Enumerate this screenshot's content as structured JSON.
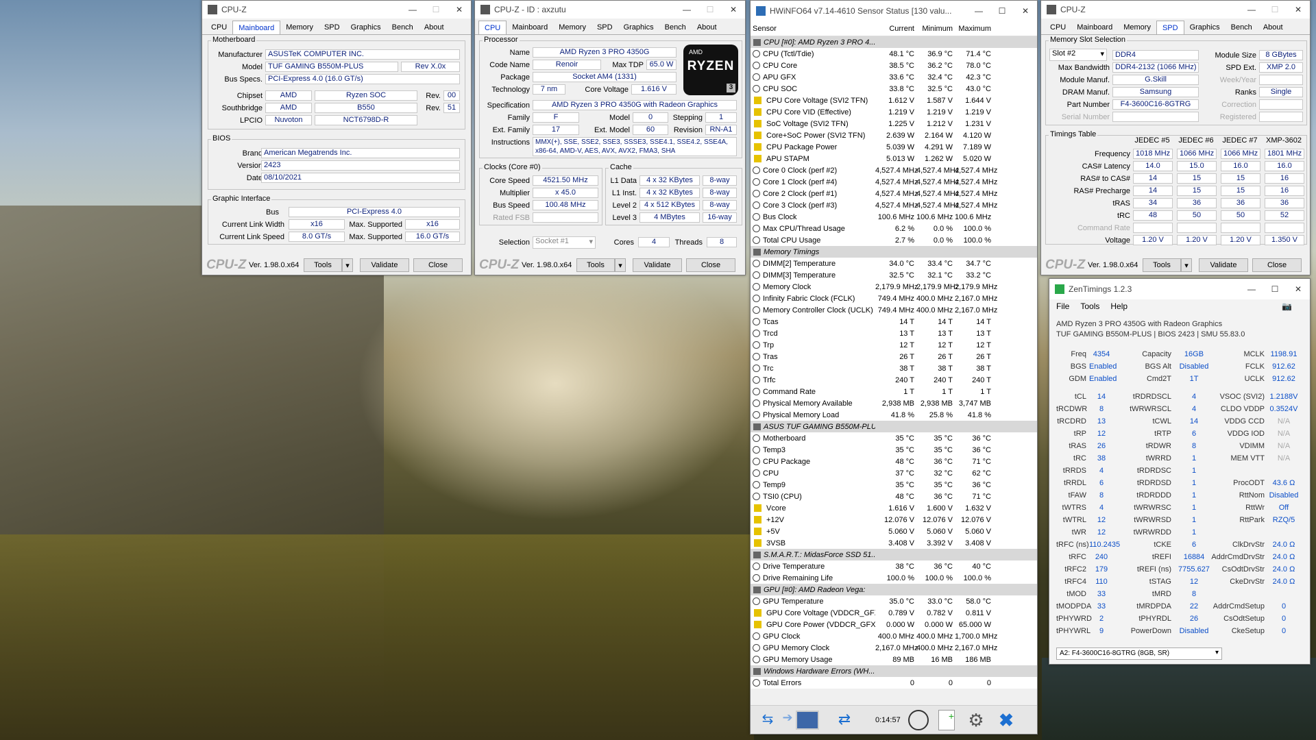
{
  "cpuz1": {
    "title": "CPU-Z",
    "tabs": [
      "CPU",
      "Mainboard",
      "Memory",
      "SPD",
      "Graphics",
      "Bench",
      "About"
    ],
    "active_tab": "Mainboard",
    "mb": {
      "title": "Motherboard",
      "manufacturer": "ASUSTeK COMPUTER INC.",
      "model": "TUF GAMING B550M-PLUS",
      "model_rev": "Rev X.0x",
      "bus_specs": "PCI-Express 4.0 (16.0 GT/s)",
      "chipset_vendor": "AMD",
      "chipset": "Ryzen SOC",
      "chipset_rev": "00",
      "sb_vendor": "AMD",
      "sb": "B550",
      "sb_rev": "51",
      "lpcio_vendor": "Nuvoton",
      "lpcio": "NCT6798D-R"
    },
    "labels": {
      "manufacturer": "Manufacturer",
      "model": "Model",
      "bus_specs": "Bus Specs.",
      "chipset": "Chipset",
      "southbridge": "Southbridge",
      "lpcio": "LPCIO",
      "rev": "Rev.",
      "brand": "Brand",
      "version": "Version",
      "date": "Date",
      "bus": "Bus",
      "cur_width": "Current Link Width",
      "max_sup": "Max. Supported",
      "cur_speed": "Current Link Speed"
    },
    "bios": {
      "title": "BIOS",
      "brand": "American Megatrends Inc.",
      "version": "2423",
      "date": "08/10/2021"
    },
    "gi": {
      "title": "Graphic Interface",
      "bus": "PCI-Express 4.0",
      "cur_width": "x16",
      "max_width": "x16",
      "cur_speed": "8.0 GT/s",
      "max_speed": "16.0 GT/s"
    },
    "footer": {
      "logo": "CPU-Z",
      "version": "Ver. 1.98.0.x64",
      "tools": "Tools",
      "validate": "Validate",
      "close": "Close"
    }
  },
  "cpuz2": {
    "title": "CPU-Z - ID : axzutu",
    "tabs": [
      "CPU",
      "Mainboard",
      "Memory",
      "SPD",
      "Graphics",
      "Bench",
      "About"
    ],
    "active_tab": "CPU",
    "labels": {
      "processor": "Processor",
      "name": "Name",
      "code_name": "Code Name",
      "max_tdp": "Max TDP",
      "package": "Package",
      "technology": "Technology",
      "core_voltage": "Core Voltage",
      "specification": "Specification",
      "family": "Family",
      "model": "Model",
      "stepping": "Stepping",
      "ext_family": "Ext. Family",
      "ext_model": "Ext. Model",
      "revision": "Revision",
      "instructions": "Instructions",
      "clocks": "Clocks (Core #0)",
      "core_speed": "Core Speed",
      "multiplier": "Multiplier",
      "bus_speed": "Bus Speed",
      "rated_fsb": "Rated FSB",
      "cache": "Cache",
      "l1d": "L1 Data",
      "l1i": "L1 Inst.",
      "l2": "Level 2",
      "l3": "Level 3",
      "selection": "Selection",
      "cores": "Cores",
      "threads": "Threads"
    },
    "proc": {
      "name": "AMD Ryzen 3 PRO 4350G",
      "code_name": "Renoir",
      "max_tdp": "65.0 W",
      "package": "Socket AM4 (1331)",
      "technology": "7 nm",
      "core_voltage": "1.616 V",
      "specification": "AMD Ryzen 3 PRO 4350G with Radeon Graphics",
      "family": "F",
      "model": "0",
      "stepping": "1",
      "ext_family": "17",
      "ext_model": "60",
      "revision": "RN-A1",
      "instructions1": "MMX(+), SSE, SSE2, SSE3, SSSE3, SSE4.1, SSE4.2, SSE4A,",
      "instructions2": "x86-64, AMD-V, AES, AVX, AVX2, FMA3, SHA"
    },
    "badge": {
      "brand": "AMD",
      "line": "RYZEN",
      "tier": "3"
    },
    "clocks": {
      "core_speed": "4521.50 MHz",
      "multiplier": "x 45.0",
      "bus_speed": "100.48 MHz",
      "rated_fsb": ""
    },
    "cache": {
      "l1d": "4 x 32 KBytes",
      "l1d_way": "8-way",
      "l1i": "4 x 32 KBytes",
      "l1i_way": "8-way",
      "l2": "4 x 512 KBytes",
      "l2_way": "8-way",
      "l3": "4 MBytes",
      "l3_way": "16-way"
    },
    "sel": {
      "selection": "Socket #1",
      "cores": "4",
      "threads": "8"
    },
    "footer": {
      "logo": "CPU-Z",
      "version": "Ver. 1.98.0.x64",
      "tools": "Tools",
      "validate": "Validate",
      "close": "Close"
    }
  },
  "hwinfo": {
    "title": "HWiNFO64 v7.14-4610 Sensor Status [130 valu...",
    "headers": [
      "Sensor",
      "Current",
      "Minimum",
      "Maximum"
    ],
    "rows": [
      {
        "t": "s",
        "n": "CPU [#0]: AMD Ryzen 3 PRO 4..."
      },
      {
        "t": "t",
        "n": "CPU (Tctl/Tdie)",
        "c": "48.1 °C",
        "mi": "36.9 °C",
        "ma": "71.4 °C"
      },
      {
        "t": "t",
        "n": "CPU Core",
        "c": "38.5 °C",
        "mi": "36.2 °C",
        "ma": "78.0 °C"
      },
      {
        "t": "t",
        "n": "APU GFX",
        "c": "33.6 °C",
        "mi": "32.4 °C",
        "ma": "42.3 °C"
      },
      {
        "t": "t",
        "n": "CPU SOC",
        "c": "33.8 °C",
        "mi": "32.5 °C",
        "ma": "43.0 °C"
      },
      {
        "t": "v",
        "n": "CPU Core Voltage (SVI2 TFN)",
        "c": "1.612 V",
        "mi": "1.587 V",
        "ma": "1.644 V"
      },
      {
        "t": "v",
        "n": "CPU Core VID (Effective)",
        "c": "1.219 V",
        "mi": "1.219 V",
        "ma": "1.219 V"
      },
      {
        "t": "v",
        "n": "SoC Voltage (SVI2 TFN)",
        "c": "1.225 V",
        "mi": "1.212 V",
        "ma": "1.231 V"
      },
      {
        "t": "v",
        "n": "Core+SoC Power (SVI2 TFN)",
        "c": "2.639 W",
        "mi": "2.164 W",
        "ma": "4.120 W"
      },
      {
        "t": "v",
        "n": "CPU Package Power",
        "c": "5.039 W",
        "mi": "4.291 W",
        "ma": "7.189 W"
      },
      {
        "t": "v",
        "n": "APU STAPM",
        "c": "5.013 W",
        "mi": "1.262 W",
        "ma": "5.020 W"
      },
      {
        "t": "t",
        "n": "Core 0 Clock (perf #2)",
        "c": "4,527.4 MHz",
        "mi": "4,527.4 MHz",
        "ma": "4,527.4 MHz"
      },
      {
        "t": "t",
        "n": "Core 1 Clock (perf #4)",
        "c": "4,527.4 MHz",
        "mi": "4,527.4 MHz",
        "ma": "4,527.4 MHz"
      },
      {
        "t": "t",
        "n": "Core 2 Clock (perf #1)",
        "c": "4,527.4 MHz",
        "mi": "4,527.4 MHz",
        "ma": "4,527.4 MHz"
      },
      {
        "t": "t",
        "n": "Core 3 Clock (perf #3)",
        "c": "4,527.4 MHz",
        "mi": "4,527.4 MHz",
        "ma": "4,527.4 MHz"
      },
      {
        "t": "t",
        "n": "Bus Clock",
        "c": "100.6 MHz",
        "mi": "100.6 MHz",
        "ma": "100.6 MHz"
      },
      {
        "t": "t",
        "n": "Max CPU/Thread Usage",
        "c": "6.2 %",
        "mi": "0.0 %",
        "ma": "100.0 %"
      },
      {
        "t": "t",
        "n": "Total CPU Usage",
        "c": "2.7 %",
        "mi": "0.0 %",
        "ma": "100.0 %"
      },
      {
        "t": "s",
        "n": "Memory Timings"
      },
      {
        "t": "t",
        "n": "DIMM[2] Temperature",
        "c": "34.0 °C",
        "mi": "33.4 °C",
        "ma": "34.7 °C"
      },
      {
        "t": "t",
        "n": "DIMM[3] Temperature",
        "c": "32.5 °C",
        "mi": "32.1 °C",
        "ma": "33.2 °C"
      },
      {
        "t": "t",
        "n": "Memory Clock",
        "c": "2,179.9 MHz",
        "mi": "2,179.9 MHz",
        "ma": "2,179.9 MHz"
      },
      {
        "t": "t",
        "n": "Infinity Fabric Clock (FCLK)",
        "c": "749.4 MHz",
        "mi": "400.0 MHz",
        "ma": "2,167.0 MHz"
      },
      {
        "t": "t",
        "n": "Memory Controller Clock (UCLK)",
        "c": "749.4 MHz",
        "mi": "400.0 MHz",
        "ma": "2,167.0 MHz"
      },
      {
        "t": "t",
        "n": "Tcas",
        "c": "14 T",
        "mi": "14 T",
        "ma": "14 T"
      },
      {
        "t": "t",
        "n": "Trcd",
        "c": "13 T",
        "mi": "13 T",
        "ma": "13 T"
      },
      {
        "t": "t",
        "n": "Trp",
        "c": "12 T",
        "mi": "12 T",
        "ma": "12 T"
      },
      {
        "t": "t",
        "n": "Tras",
        "c": "26 T",
        "mi": "26 T",
        "ma": "26 T"
      },
      {
        "t": "t",
        "n": "Trc",
        "c": "38 T",
        "mi": "38 T",
        "ma": "38 T"
      },
      {
        "t": "t",
        "n": "Trfc",
        "c": "240 T",
        "mi": "240 T",
        "ma": "240 T"
      },
      {
        "t": "t",
        "n": "Command Rate",
        "c": "1 T",
        "mi": "1 T",
        "ma": "1 T"
      },
      {
        "t": "t",
        "n": "Physical Memory Available",
        "c": "2,938 MB",
        "mi": "2,938 MB",
        "ma": "3,747 MB"
      },
      {
        "t": "t",
        "n": "Physical Memory Load",
        "c": "41.8 %",
        "mi": "25.8 %",
        "ma": "41.8 %"
      },
      {
        "t": "s",
        "n": "ASUS TUF GAMING B550M-PLU..."
      },
      {
        "t": "t",
        "n": "Motherboard",
        "c": "35 °C",
        "mi": "35 °C",
        "ma": "36 °C"
      },
      {
        "t": "t",
        "n": "Temp3",
        "c": "35 °C",
        "mi": "35 °C",
        "ma": "36 °C"
      },
      {
        "t": "t",
        "n": "CPU Package",
        "c": "48 °C",
        "mi": "36 °C",
        "ma": "71 °C"
      },
      {
        "t": "t",
        "n": "CPU",
        "c": "37 °C",
        "mi": "32 °C",
        "ma": "62 °C"
      },
      {
        "t": "t",
        "n": "Temp9",
        "c": "35 °C",
        "mi": "35 °C",
        "ma": "36 °C"
      },
      {
        "t": "t",
        "n": "TSI0 (CPU)",
        "c": "48 °C",
        "mi": "36 °C",
        "ma": "71 °C"
      },
      {
        "t": "v",
        "n": "Vcore",
        "c": "1.616 V",
        "mi": "1.600 V",
        "ma": "1.632 V"
      },
      {
        "t": "v",
        "n": "+12V",
        "c": "12.076 V",
        "mi": "12.076 V",
        "ma": "12.076 V"
      },
      {
        "t": "v",
        "n": "+5V",
        "c": "5.060 V",
        "mi": "5.060 V",
        "ma": "5.060 V"
      },
      {
        "t": "v",
        "n": "3VSB",
        "c": "3.408 V",
        "mi": "3.392 V",
        "ma": "3.408 V"
      },
      {
        "t": "s",
        "n": "S.M.A.R.T.: MidasForce SSD 51..."
      },
      {
        "t": "t",
        "n": "Drive Temperature",
        "c": "38 °C",
        "mi": "36 °C",
        "ma": "40 °C"
      },
      {
        "t": "t",
        "n": "Drive Remaining Life",
        "c": "100.0 %",
        "mi": "100.0 %",
        "ma": "100.0 %"
      },
      {
        "t": "s",
        "n": "GPU [#0]: AMD Radeon Vega:"
      },
      {
        "t": "t",
        "n": "GPU Temperature",
        "c": "35.0 °C",
        "mi": "33.0 °C",
        "ma": "58.0 °C"
      },
      {
        "t": "v",
        "n": "GPU Core Voltage (VDDCR_GFX)",
        "c": "0.789 V",
        "mi": "0.782 V",
        "ma": "0.811 V"
      },
      {
        "t": "v",
        "n": "GPU Core Power (VDDCR_GFX)",
        "c": "0.000 W",
        "mi": "0.000 W",
        "ma": "65.000 W"
      },
      {
        "t": "t",
        "n": "GPU Clock",
        "c": "400.0 MHz",
        "mi": "400.0 MHz",
        "ma": "1,700.0 MHz"
      },
      {
        "t": "t",
        "n": "GPU Memory Clock",
        "c": "2,167.0 MHz",
        "mi": "400.0 MHz",
        "ma": "2,167.0 MHz"
      },
      {
        "t": "t",
        "n": "GPU Memory Usage",
        "c": "89 MB",
        "mi": "16 MB",
        "ma": "186 MB"
      },
      {
        "t": "s",
        "n": "Windows Hardware Errors (WH..."
      },
      {
        "t": "t",
        "n": "Total Errors",
        "c": "0",
        "mi": "0",
        "ma": "0"
      }
    ],
    "timer": "0:14:57"
  },
  "cpuz3": {
    "title": "CPU-Z",
    "tabs": [
      "CPU",
      "Mainboard",
      "Memory",
      "SPD",
      "Graphics",
      "Bench",
      "About"
    ],
    "active_tab": "SPD",
    "labels": {
      "slot_sel": "Memory Slot Selection",
      "module_size": "Module Size",
      "max_bw": "Max Bandwidth",
      "spd_ext": "SPD Ext.",
      "module_manuf": "Module Manuf.",
      "week_year": "Week/Year",
      "dram_manuf": "DRAM Manuf.",
      "ranks": "Ranks",
      "part_number": "Part Number",
      "correction": "Correction",
      "serial": "Serial Number",
      "registered": "Registered",
      "timings": "Timings Table",
      "frequency": "Frequency",
      "cas": "CAS# Latency",
      "ras_cas": "RAS# to CAS#",
      "ras_pre": "RAS# Precharge",
      "tras": "tRAS",
      "trc": "tRC",
      "cmd_rate": "Command Rate",
      "voltage": "Voltage"
    },
    "slot": {
      "selected": "Slot #2",
      "type": "DDR4",
      "module_size": "8 GBytes",
      "max_bw": "DDR4-2132 (1066 MHz)",
      "spd_ext": "XMP 2.0",
      "module_manuf": "G.Skill",
      "dram_manuf": "Samsung",
      "ranks": "Single",
      "part_number": "F4-3600C16-8GTRG"
    },
    "cols": [
      "JEDEC #5",
      "JEDEC #6",
      "JEDEC #7",
      "XMP-3602"
    ],
    "freq": [
      "1018 MHz",
      "1066 MHz",
      "1066 MHz",
      "1801 MHz"
    ],
    "cas": [
      "14.0",
      "15.0",
      "16.0",
      "16.0"
    ],
    "rcd": [
      "14",
      "15",
      "15",
      "16"
    ],
    "rp": [
      "14",
      "15",
      "15",
      "16"
    ],
    "tras": [
      "34",
      "36",
      "36",
      "36"
    ],
    "trc": [
      "48",
      "50",
      "50",
      "52"
    ],
    "volt": [
      "1.20 V",
      "1.20 V",
      "1.20 V",
      "1.350 V"
    ],
    "footer": {
      "logo": "CPU-Z",
      "version": "Ver. 1.98.0.x64",
      "tools": "Tools",
      "validate": "Validate",
      "close": "Close"
    }
  },
  "zen": {
    "title": "ZenTimings 1.2.3",
    "menu": [
      "File",
      "Tools",
      "Help"
    ],
    "info1": "AMD Ryzen 3 PRO 4350G with Radeon Graphics",
    "info2": "TUF GAMING B550M-PLUS | BIOS 2423 | SMU 55.83.0",
    "top": [
      [
        "Freq",
        "4354",
        "Capacity",
        "16GB",
        "MCLK",
        "1198.91"
      ],
      [
        "BGS",
        "Enabled",
        "BGS Alt",
        "Disabled",
        "FCLK",
        "912.62"
      ],
      [
        "GDM",
        "Enabled",
        "Cmd2T",
        "1T",
        "UCLK",
        "912.62"
      ]
    ],
    "grid": [
      [
        "tCL",
        "14",
        "tRDRDSCL",
        "4",
        "VSOC (SVI2)",
        "1.2188V"
      ],
      [
        "tRCDWR",
        "8",
        "tWRWRSCL",
        "4",
        "CLDO VDDP",
        "0.3524V"
      ],
      [
        "tRCDRD",
        "13",
        "tCWL",
        "14",
        "VDDG CCD",
        "N/A"
      ],
      [
        "tRP",
        "12",
        "tRTP",
        "6",
        "VDDG IOD",
        "N/A"
      ],
      [
        "tRAS",
        "26",
        "tRDWR",
        "8",
        "VDIMM",
        "N/A"
      ],
      [
        "tRC",
        "38",
        "tWRRD",
        "1",
        "MEM VTT",
        "N/A"
      ],
      [
        "tRRDS",
        "4",
        "tRDRDSC",
        "1",
        "",
        ""
      ],
      [
        "tRRDL",
        "6",
        "tRDRDSD",
        "1",
        "ProcODT",
        "43.6 Ω"
      ],
      [
        "tFAW",
        "8",
        "tRDRDDD",
        "1",
        "RttNom",
        "Disabled"
      ],
      [
        "tWTRS",
        "4",
        "tWRWRSC",
        "1",
        "RttWr",
        "Off"
      ],
      [
        "tWTRL",
        "12",
        "tWRWRSD",
        "1",
        "RttPark",
        "RZQ/5"
      ],
      [
        "tWR",
        "12",
        "tWRWRDD",
        "1",
        "",
        ""
      ],
      [
        "tRFC (ns)",
        "110.2435",
        "tCKE",
        "6",
        "ClkDrvStr",
        "24.0 Ω"
      ],
      [
        "tRFC",
        "240",
        "tREFI",
        "16884",
        "AddrCmdDrvStr",
        "24.0 Ω"
      ],
      [
        "tRFC2",
        "179",
        "tREFI (ns)",
        "7755.627",
        "CsOdtDrvStr",
        "24.0 Ω"
      ],
      [
        "tRFC4",
        "110",
        "tSTAG",
        "12",
        "CkeDrvStr",
        "24.0 Ω"
      ],
      [
        "tMOD",
        "33",
        "tMRD",
        "8",
        "",
        ""
      ],
      [
        "tMODPDA",
        "33",
        "tMRDPDA",
        "22",
        "AddrCmdSetup",
        "0"
      ],
      [
        "tPHYWRD",
        "2",
        "tPHYRDL",
        "26",
        "CsOdtSetup",
        "0"
      ],
      [
        "tPHYWRL",
        "9",
        "PowerDown",
        "Disabled",
        "CkeSetup",
        "0"
      ]
    ],
    "dimm": "A2: F4-3600C16-8GTRG (8GB, SR)"
  }
}
